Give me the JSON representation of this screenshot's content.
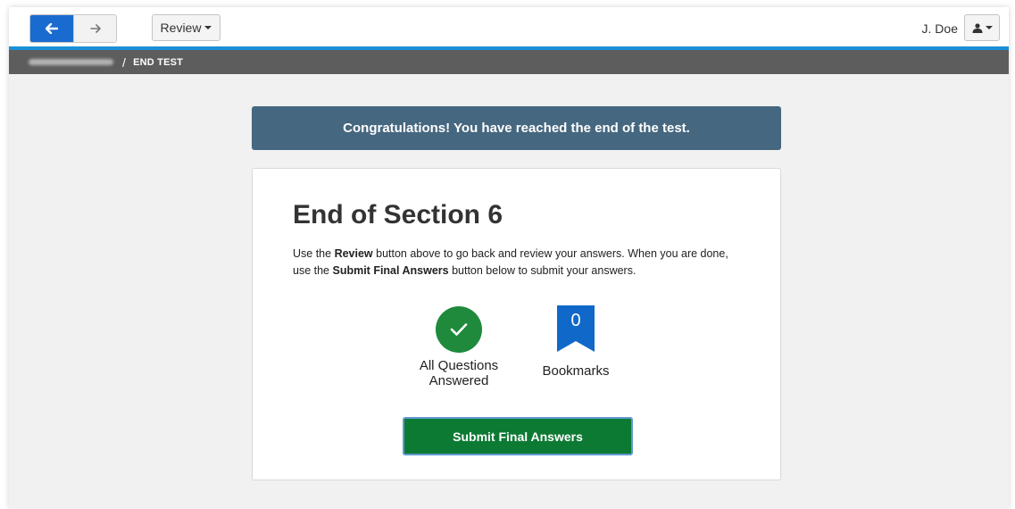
{
  "toolbar": {
    "review_label": "Review",
    "user_name": "J. Doe"
  },
  "breadcrumb": {
    "current": "END TEST"
  },
  "banner": {
    "text": "Congratulations! You have reached the end of the test."
  },
  "card": {
    "title": "End of Section 6",
    "text_1": "Use the ",
    "text_review": "Review",
    "text_2": " button above to go back and review your answers. When you are done, use the ",
    "text_submit": "Submit Final Answers",
    "text_3": " button below to submit your answers.",
    "status_answered_line1": "All Questions",
    "status_answered_line2": "Answered",
    "bookmarks_count": "0",
    "bookmarks_label": "Bookmarks",
    "submit_label": "Submit Final Answers"
  },
  "colors": {
    "accent_blue": "#1a6bd0",
    "banner_bg": "#45677f",
    "success_green": "#1f8a3c",
    "bookmark_blue": "#1068c8"
  },
  "icons": {
    "back": "arrow-left-icon",
    "forward": "arrow-right-icon",
    "user": "user-icon",
    "check": "check-icon",
    "bookmark": "bookmark-icon"
  }
}
